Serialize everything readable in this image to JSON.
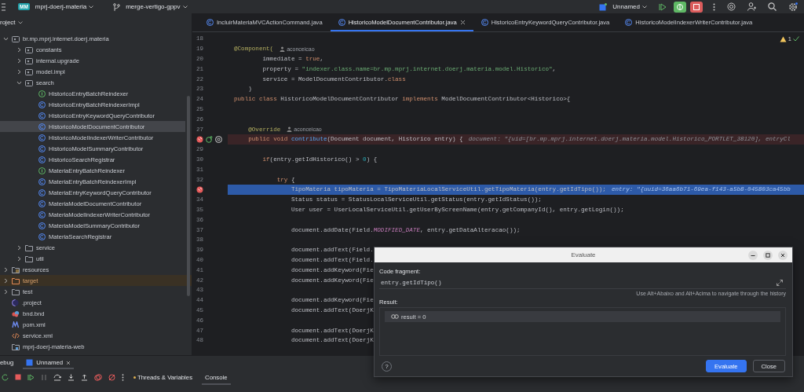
{
  "top_bar": {
    "project": {
      "badge": "MM",
      "name": "mprj-doerj-materia"
    },
    "branch": "merge-vertigo-gppv",
    "run_config": "Unnamed"
  },
  "project_panel": {
    "title": "roject",
    "tree": [
      {
        "label": "br.mp.mprj.internet.doerj.materia",
        "kind": "package",
        "expanded": true,
        "selected": false,
        "children": [
          {
            "label": "constants",
            "kind": "package",
            "expanded": false,
            "selected": false
          },
          {
            "label": "internal.upgrade",
            "kind": "package",
            "expanded": false,
            "selected": false
          },
          {
            "label": "model.impl",
            "kind": "package",
            "expanded": false,
            "selected": false
          },
          {
            "label": "search",
            "kind": "package",
            "expanded": true,
            "selected": false,
            "children": [
              {
                "label": "HistoricoEntryBatchReindexer",
                "kind": "interface",
                "selected": false
              },
              {
                "label": "HistoricoEntryBatchReindexerImpl",
                "kind": "class",
                "selected": false
              },
              {
                "label": "HistoricoEntryKeywordQueryContributor",
                "kind": "class",
                "selected": false
              },
              {
                "label": "HistoricoModelDocumentContributor",
                "kind": "class",
                "selected": true
              },
              {
                "label": "HistoricoModelIndexerWriterContributor",
                "kind": "class",
                "selected": false
              },
              {
                "label": "HistoricoModelSummaryContributor",
                "kind": "class",
                "selected": false
              },
              {
                "label": "HistoricoSearchRegistrar",
                "kind": "class",
                "selected": false
              },
              {
                "label": "MateriaEntryBatchReindexer",
                "kind": "interface",
                "selected": false
              },
              {
                "label": "MateriaEntryBatchReindexerImpl",
                "kind": "class",
                "selected": false
              },
              {
                "label": "MateriaEntryKeywordQueryContributor",
                "kind": "class",
                "selected": false
              },
              {
                "label": "MateriaModelDocumentContributor",
                "kind": "class",
                "selected": false
              },
              {
                "label": "MateriaModelIndexerWriterContributor",
                "kind": "class",
                "selected": false
              },
              {
                "label": "MateriaModelSummaryContributor",
                "kind": "class",
                "selected": false
              },
              {
                "label": "MateriaSearchRegistrar",
                "kind": "class",
                "selected": false
              }
            ]
          },
          {
            "label": "service",
            "kind": "folder",
            "expanded": false,
            "selected": false
          },
          {
            "label": "util",
            "kind": "folder",
            "expanded": false,
            "selected": false
          }
        ]
      },
      {
        "label": "resources",
        "kind": "resources",
        "expanded": false,
        "selected": false
      },
      {
        "label": "target",
        "kind": "excluded",
        "expanded": false,
        "selected": false
      },
      {
        "label": "test",
        "kind": "folder",
        "expanded": false,
        "selected": false
      },
      {
        "label": ".project",
        "kind": "eclipse",
        "selected": false
      },
      {
        "label": "bnd.bnd",
        "kind": "bnd",
        "selected": false
      },
      {
        "label": "pom.xml",
        "kind": "maven",
        "selected": false
      },
      {
        "label": "service.xml",
        "kind": "xml",
        "selected": false
      },
      {
        "label": "mprj-doerj-materia-web",
        "kind": "module",
        "selected": false
      }
    ]
  },
  "editor_tabs": [
    {
      "label": "IncluirMateriaMVCActionCommand.java",
      "selected": false
    },
    {
      "label": "HistoricoModelDocumentContributor.java",
      "selected": true
    },
    {
      "label": "HistoricoEntryKeywordQueryContributor.java",
      "selected": false
    },
    {
      "label": "HistoricoModelIndexerWriterContributor.java",
      "selected": false
    }
  ],
  "editor": {
    "warnings": "1",
    "lines": [
      {
        "number": "18",
        "breakpoint": false,
        "current": false
      },
      {
        "number": "19",
        "breakpoint": false,
        "current": false,
        "segments": [
          {
            "text": "@Component(",
            "kind": "annotation"
          }
        ],
        "author": "aconceicao"
      },
      {
        "number": "20",
        "breakpoint": false,
        "current": false,
        "segments": [
          {
            "text": "        immediate = ",
            "kind": "plain"
          },
          {
            "text": "true",
            "kind": "keyword"
          },
          {
            "text": ",",
            "kind": "plain"
          }
        ]
      },
      {
        "number": "21",
        "breakpoint": false,
        "current": false,
        "segments": [
          {
            "text": "        property = ",
            "kind": "plain"
          },
          {
            "text": "\"indexer.class.name=br.mp.mprj.internet.doerj.materia.model.Historico\"",
            "kind": "string"
          },
          {
            "text": ",",
            "kind": "plain"
          }
        ]
      },
      {
        "number": "22",
        "breakpoint": false,
        "current": false,
        "segments": [
          {
            "text": "        service = ModelDocumentContributor.",
            "kind": "plain"
          },
          {
            "text": "class",
            "kind": "keyword"
          }
        ]
      },
      {
        "number": "23",
        "breakpoint": false,
        "current": false,
        "segments": [
          {
            "text": "    )",
            "kind": "plain"
          }
        ]
      },
      {
        "number": "24",
        "breakpoint": false,
        "current": false,
        "segments": [
          {
            "text": "public class ",
            "kind": "keyword"
          },
          {
            "text": "HistoricoModelDocumentContributor ",
            "kind": "plain"
          },
          {
            "text": "implements ",
            "kind": "keyword"
          },
          {
            "text": "ModelDocumentContributor<Historico>{",
            "kind": "plain"
          }
        ]
      },
      {
        "number": "25",
        "breakpoint": false,
        "current": false
      },
      {
        "number": "26",
        "breakpoint": false,
        "current": false
      },
      {
        "number": "27",
        "breakpoint": false,
        "current": false,
        "segments": [
          {
            "text": "    @Override",
            "kind": "annotation"
          }
        ],
        "author": "aconceicao"
      },
      {
        "breakpoint": true,
        "current": false,
        "overrides": true,
        "segments": [
          {
            "text": "    public void ",
            "kind": "keyword"
          },
          {
            "text": "contribute",
            "kind": "method"
          },
          {
            "text": "(Document document, Historico entry) {",
            "kind": "plain"
          }
        ],
        "hint": "document: \"{uid=[br.mp.mprj.internet.doerj.materia.model.Historico_PORTLET_38120], entryCl"
      },
      {
        "number": "29",
        "breakpoint": false,
        "current": false
      },
      {
        "number": "30",
        "breakpoint": false,
        "current": false,
        "segments": [
          {
            "text": "        if",
            "kind": "keyword"
          },
          {
            "text": "(entry.getIdHistorico() > ",
            "kind": "plain"
          },
          {
            "text": "0",
            "kind": "number"
          },
          {
            "text": ") {",
            "kind": "plain"
          }
        ]
      },
      {
        "number": "31",
        "breakpoint": false,
        "current": false
      },
      {
        "number": "32",
        "breakpoint": false,
        "current": false,
        "segments": [
          {
            "text": "            try",
            "kind": "keyword"
          },
          {
            "text": " {",
            "kind": "plain"
          }
        ]
      },
      {
        "breakpoint": true,
        "current": true,
        "segments": [
          {
            "text": "                TipoMateria tipoMateria = TipoMateriaLocalServiceUtil.getTipoMateria(entry.getIdTipo());",
            "kind": "plain"
          }
        ],
        "hint": "entry: \"{uuid=36aa6b71-69ea-f143-a5b8-045803ca45bb"
      },
      {
        "number": "34",
        "breakpoint": false,
        "current": false,
        "segments": [
          {
            "text": "                Status status = StatusLocalServiceUtil.getStatus(entry.getIdStatus());",
            "kind": "plain"
          }
        ]
      },
      {
        "number": "35",
        "breakpoint": false,
        "current": false,
        "segments": [
          {
            "text": "                User user = UserLocalServiceUtil.getUserByScreenName(entry.getCompanyId(), entry.getLogin());",
            "kind": "plain"
          }
        ]
      },
      {
        "number": "36",
        "breakpoint": false,
        "current": false
      },
      {
        "number": "37",
        "breakpoint": false,
        "current": false,
        "segments": [
          {
            "text": "                document.addDate(Field.",
            "kind": "plain"
          },
          {
            "text": "MODIFIED_DATE",
            "kind": "constant"
          },
          {
            "text": ", entry.getDataAlteracao());",
            "kind": "plain"
          }
        ]
      },
      {
        "number": "38",
        "breakpoint": false,
        "current": false
      },
      {
        "number": "39",
        "breakpoint": false,
        "current": false,
        "segments": [
          {
            "text": "                document.addText(Field.",
            "kind": "plain"
          }
        ]
      },
      {
        "number": "40",
        "breakpoint": false,
        "current": false,
        "segments": [
          {
            "text": "                document.addText(Field.",
            "kind": "plain"
          }
        ]
      },
      {
        "number": "41",
        "breakpoint": false,
        "current": false,
        "segments": [
          {
            "text": "                document.addKeyword(Fie",
            "kind": "plain"
          }
        ]
      },
      {
        "number": "42",
        "breakpoint": false,
        "current": false,
        "segments": [
          {
            "text": "                document.addKeyword(Fie",
            "kind": "plain"
          }
        ]
      },
      {
        "number": "43",
        "breakpoint": false,
        "current": false
      },
      {
        "number": "44",
        "breakpoint": false,
        "current": false,
        "segments": [
          {
            "text": "                document.addKeyword(Fie",
            "kind": "plain"
          }
        ]
      },
      {
        "number": "45",
        "breakpoint": false,
        "current": false,
        "segments": [
          {
            "text": "                document.addText(DoerjK",
            "kind": "plain"
          }
        ]
      },
      {
        "number": "46",
        "breakpoint": false,
        "current": false
      },
      {
        "number": "47",
        "breakpoint": false,
        "current": false,
        "segments": [
          {
            "text": "                document.addText(DoerjK",
            "kind": "plain"
          }
        ]
      },
      {
        "number": "48",
        "breakpoint": false,
        "current": false,
        "segments": [
          {
            "text": "                document.addText(DoerjK",
            "kind": "plain"
          }
        ]
      }
    ]
  },
  "evaluate_dialog": {
    "title": "Evaluate",
    "fragment_label": "Code fragment:",
    "fragment": "entry.getIdTipo()",
    "history_hint": "Use Alt+Abaixo and Alt+Acima to navigate through the history",
    "result_label": "Result:",
    "result": "result = 0",
    "help": "?",
    "buttons": [
      {
        "label": "Evaluate",
        "kind": "primary"
      },
      {
        "label": "Close",
        "kind": "secondary"
      }
    ]
  },
  "debug_panel": {
    "title": "ebug",
    "session": "Unnamed",
    "tabs": [
      {
        "label": "Threads & Variables",
        "selected": false
      },
      {
        "label": "Console",
        "selected": true
      }
    ]
  }
}
